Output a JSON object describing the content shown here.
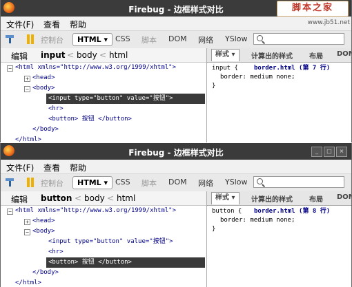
{
  "watermark": {
    "logo": "脚本之家",
    "url": "www.jb51.net"
  },
  "windows": [
    {
      "title": "Firebug - 边框样式对比",
      "menu": [
        "文件(F)",
        "查看",
        "帮助"
      ],
      "toolbar": {
        "console": "控制台",
        "html": "HTML ▾",
        "css": "CSS",
        "script": "脚本",
        "dom": "DOM",
        "net": "网络",
        "yslow": "YSlow"
      },
      "breadcrumb": {
        "edit": "编辑",
        "c1": "input",
        "c2": "body",
        "c3": "html",
        "sep": "<"
      },
      "right_tabs": {
        "style": "样式 ▾",
        "computed": "计算出的样式",
        "layout": "布局",
        "dom": "DOM"
      },
      "tree": {
        "html_open": "<html xmlns=\"http://www.w3.org/1999/xhtml\">",
        "head": "<head>",
        "body_open": "<body>",
        "input": "<input type=\"button\" value=\"按钮\">",
        "hr": "<hr>",
        "button": "<button> 按钮 </button>",
        "body_close": "</body>",
        "html_close": "</html>"
      },
      "css": {
        "selector": "input {",
        "source": "border.html (第 7 行)",
        "prop": "border: medium none;",
        "close": "}"
      }
    },
    {
      "title": "Firebug - 边框样式对比",
      "menu": [
        "文件(F)",
        "查看",
        "帮助"
      ],
      "toolbar": {
        "console": "控制台",
        "html": "HTML ▾",
        "css": "CSS",
        "script": "脚本",
        "dom": "DOM",
        "net": "网络",
        "yslow": "YSlow"
      },
      "breadcrumb": {
        "edit": "编辑",
        "c1": "button",
        "c2": "body",
        "c3": "html",
        "sep": "<"
      },
      "right_tabs": {
        "style": "样式 ▾",
        "computed": "计算出的样式",
        "layout": "布局",
        "dom": "DOM"
      },
      "tree": {
        "html_open": "<html xmlns=\"http://www.w3.org/1999/xhtml\">",
        "head": "<head>",
        "body_open": "<body>",
        "input": "<input type=\"button\" value=\"按钮\">",
        "hr": "<hr>",
        "button": "<button> 按钮 </button>",
        "body_close": "</body>",
        "html_close": "</html>"
      },
      "css": {
        "selector": "button {",
        "source": "border.html (第 8 行)",
        "prop": "border: medium none;",
        "close": "}"
      }
    }
  ]
}
